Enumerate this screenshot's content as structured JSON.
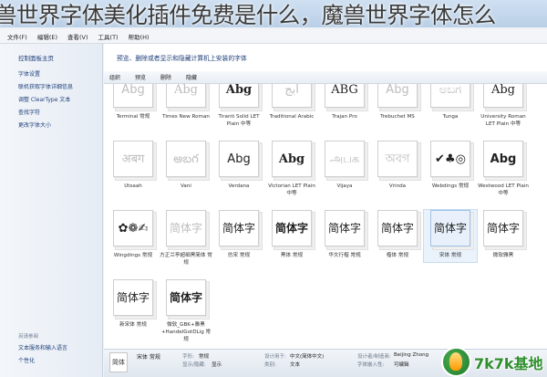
{
  "banner": {
    "text": "兽世界字体美化插件免费是什么，魔兽世界字体怎么"
  },
  "menu": [
    "文件(F)",
    "编辑(E)",
    "查看(V)",
    "工具(T)",
    "帮助(H)"
  ],
  "leftnav": {
    "home": "控制面板主页",
    "links": [
      "字体设置",
      "联机获取字体详细信息",
      "调整 ClearType 文本",
      "查找字符",
      "更改字体大小"
    ],
    "see_also_heading": "另请参阅",
    "see_also": [
      "文本服务和输入语言",
      "个性化"
    ]
  },
  "header": {
    "description": "预览、删除或者显示和隐藏计算机上安装的字体"
  },
  "toolbar": [
    "组织",
    "预览",
    "删除",
    "隐藏"
  ],
  "fonts": [
    {
      "name": "Terminal 常规",
      "sample": "Abg",
      "style": "faded"
    },
    {
      "name": "Times New Roman",
      "sample": "Abg",
      "style": "faded serif"
    },
    {
      "name": "Tiranti Solid LET Plain 中等",
      "sample": "Abg",
      "style": "dark serif bold"
    },
    {
      "name": "Traditional Arabic",
      "sample": "ابج",
      "style": "faded"
    },
    {
      "name": "Trajan Pro",
      "sample": "ABG",
      "style": "dark serif"
    },
    {
      "name": "Trebuchet MS",
      "sample": "Abg",
      "style": "faded"
    },
    {
      "name": "Tunga",
      "sample": "ಅಬಗ",
      "style": "faded"
    },
    {
      "name": "University Roman LET Plain 中等",
      "sample": "Abg",
      "style": "dark serif"
    },
    {
      "name": "Utsaah",
      "sample": "अबग",
      "style": "faded"
    },
    {
      "name": "Vani",
      "sample": "అబగ",
      "style": "faded"
    },
    {
      "name": "Verdana",
      "sample": "Abg",
      "style": "dark"
    },
    {
      "name": "Victorian LET Plain 中等",
      "sample": "Abg",
      "style": "dark serif bold"
    },
    {
      "name": "Vijaya",
      "sample": "அபக",
      "style": "faded"
    },
    {
      "name": "Vrinda",
      "sample": "অবগ",
      "style": "faded"
    },
    {
      "name": "Webdings 常规",
      "sample": "✔♣◎",
      "style": "dark"
    },
    {
      "name": "Westwood LET Plain 中等",
      "sample": "Abg",
      "style": "dark bold"
    },
    {
      "name": "Wingdings 常规",
      "sample": "✿❁✍",
      "style": "dark"
    },
    {
      "name": "方正兰亭超细黑简体 常规",
      "sample": "简体字",
      "style": "faded cjk"
    },
    {
      "name": "仿宋 常规",
      "sample": "简体字",
      "style": "dark cjk"
    },
    {
      "name": "黑体 常规",
      "sample": "简体字",
      "style": "dark cjk bold"
    },
    {
      "name": "华文行楷 常规",
      "sample": "简体字",
      "style": "dark cjk serif"
    },
    {
      "name": "楷体 常规",
      "sample": "简体字",
      "style": "dark cjk serif"
    },
    {
      "name": "宋体 常规",
      "sample": "简体字",
      "style": "dark cjk serif",
      "selected": true
    },
    {
      "name": "微软雅黑",
      "sample": "简体字",
      "style": "dark cjk"
    },
    {
      "name": "新宋体 常规",
      "sample": "简体字",
      "style": "dark cjk serif"
    },
    {
      "name": "微软_GBK+雅黑+HandelGotDLig 常规",
      "sample": "简体字",
      "style": "dark cjk bold"
    }
  ],
  "details": {
    "thumb_sample": "简体",
    "font_name": "宋体 常规",
    "style_label": "字形:",
    "style_value": "常规",
    "show_label": "显示/隐藏:",
    "show_value": "显示",
    "designed_for_label": "设计用于:",
    "designed_for_value": "中文(简体中文)",
    "category_label": "类别:",
    "category_value": "文本",
    "designer_label": "设计者/制造商:",
    "designer_value": "Beijing Zhong",
    "embed_label": "字体嵌入性:",
    "embed_value": "可编辑"
  },
  "watermark": {
    "text": "7k7k基地"
  }
}
